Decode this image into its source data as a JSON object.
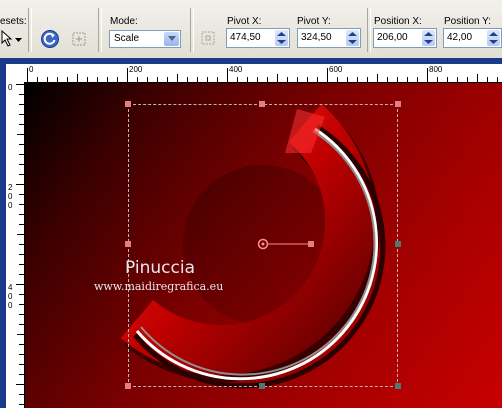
{
  "toolbar": {
    "presets_label": "esets:",
    "mode_label": "Mode:",
    "mode_value": "Scale",
    "pivot_x_label": "Pivot X:",
    "pivot_x_value": "474,50",
    "pivot_y_label": "Pivot Y:",
    "pivot_y_value": "324,50",
    "position_x_label": "Position X:",
    "position_x_value": "206,00",
    "position_y_label": "Position Y:",
    "position_y_value": "42,00"
  },
  "rulers": {
    "h_labels": [
      "0",
      "200",
      "400",
      "600",
      "800"
    ],
    "v_labels": [
      "0",
      "2",
      "0",
      "0",
      "4",
      "0",
      "0"
    ]
  },
  "watermark": {
    "name": "Pinuccia",
    "url": "www.maidiregrafica.eu"
  },
  "colors": {
    "canvas_dark": "#000000",
    "canvas_red": "#c80000",
    "selection_handle": "#e08080",
    "work_bg": "#1b3a8c"
  },
  "icons": {
    "preset": "preset-pointer-icon",
    "reset": "reset-icon",
    "randomize": "randomize-icon",
    "pivot_target": "pivot-target-icon"
  }
}
